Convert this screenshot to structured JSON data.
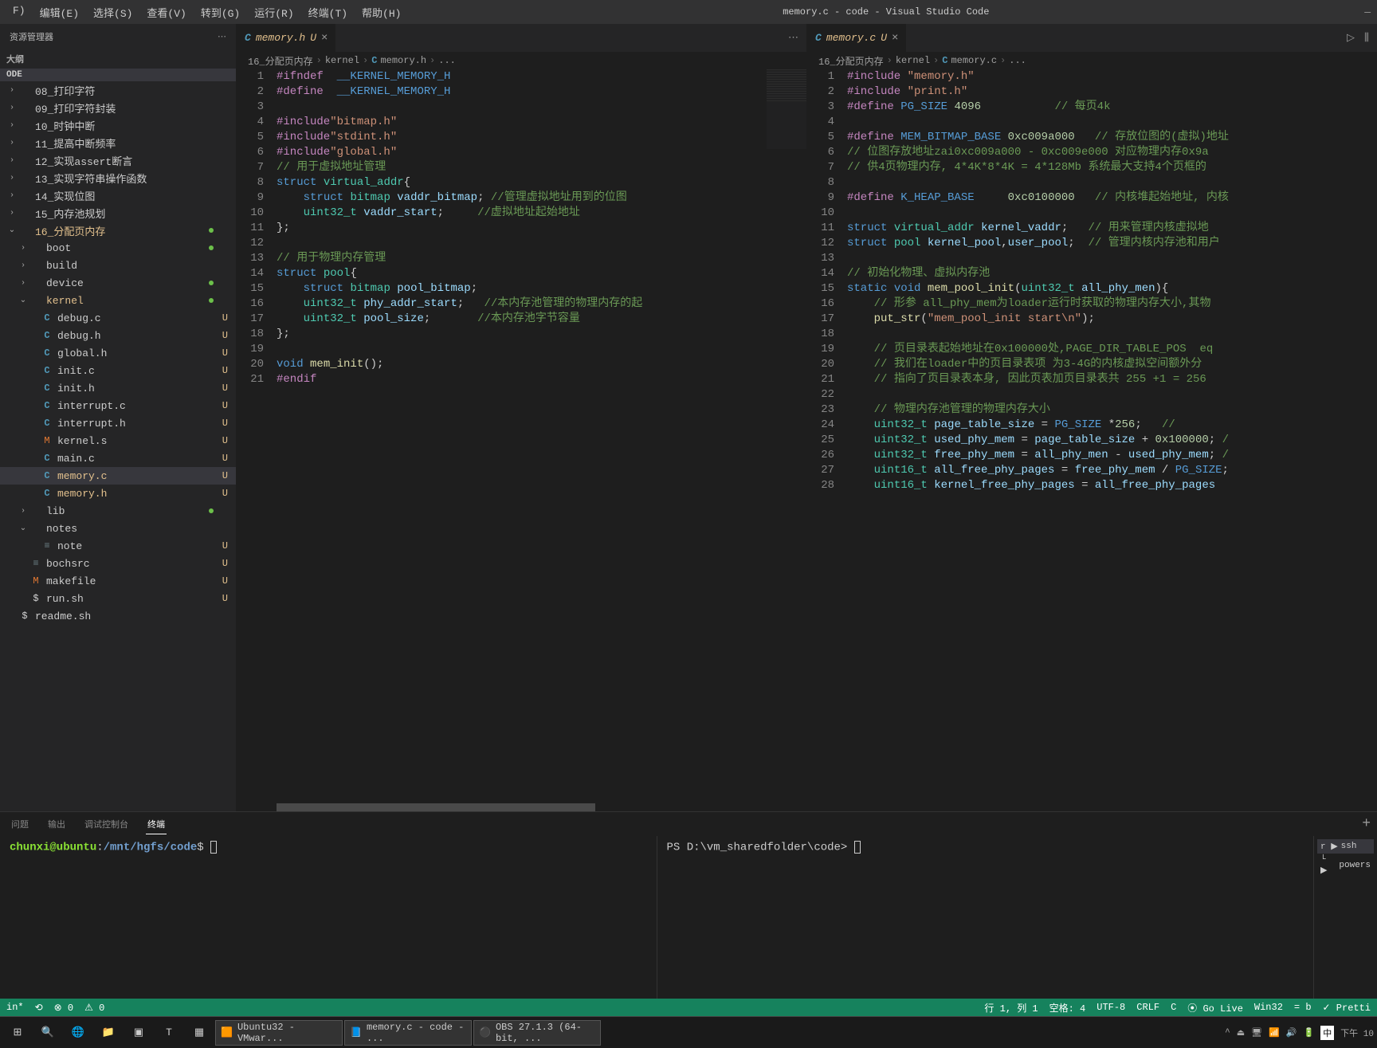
{
  "menu": {
    "items": [
      "F)",
      "编辑(E)",
      "选择(S)",
      "查看(V)",
      "转到(G)",
      "运行(R)",
      "终端(T)",
      "帮助(H)"
    ]
  },
  "window": {
    "title": "memory.c - code - Visual Studio Code"
  },
  "sidebar": {
    "title": "资源管理器",
    "outline": "大纲",
    "root": "ODE",
    "items": [
      {
        "name": "08_打印字符",
        "indent": 0,
        "kind": "folder"
      },
      {
        "name": "09_打印字符封装",
        "indent": 0,
        "kind": "folder"
      },
      {
        "name": "10_时钟中断",
        "indent": 0,
        "kind": "folder"
      },
      {
        "name": "11_提高中断频率",
        "indent": 0,
        "kind": "folder"
      },
      {
        "name": "12_实现assert断言",
        "indent": 0,
        "kind": "folder"
      },
      {
        "name": "13_实现字符串操作函数",
        "indent": 0,
        "kind": "folder"
      },
      {
        "name": "14_实现位图",
        "indent": 0,
        "kind": "folder"
      },
      {
        "name": "15_内存池规划",
        "indent": 0,
        "kind": "folder"
      },
      {
        "name": "16_分配页内存",
        "indent": 0,
        "kind": "folder",
        "open": true,
        "dot": true,
        "active": true
      },
      {
        "name": "boot",
        "indent": 1,
        "kind": "folder",
        "chev": "›",
        "dot": true
      },
      {
        "name": "build",
        "indent": 1,
        "kind": "folder",
        "chev": "›"
      },
      {
        "name": "device",
        "indent": 1,
        "kind": "folder",
        "chev": "›",
        "dot": true
      },
      {
        "name": "kernel",
        "indent": 1,
        "kind": "folder",
        "chev": "⌄",
        "open": true,
        "dot": true,
        "active": true
      },
      {
        "name": "debug.c",
        "indent": 2,
        "kind": "c",
        "status": "U"
      },
      {
        "name": "debug.h",
        "indent": 2,
        "kind": "c",
        "status": "U"
      },
      {
        "name": "global.h",
        "indent": 2,
        "kind": "c",
        "status": "U"
      },
      {
        "name": "init.c",
        "indent": 2,
        "kind": "c",
        "status": "U"
      },
      {
        "name": "init.h",
        "indent": 2,
        "kind": "c",
        "status": "U"
      },
      {
        "name": "interrupt.c",
        "indent": 2,
        "kind": "c",
        "status": "U"
      },
      {
        "name": "interrupt.h",
        "indent": 2,
        "kind": "c",
        "status": "U"
      },
      {
        "name": "kernel.s",
        "indent": 2,
        "kind": "m",
        "status": "U"
      },
      {
        "name": "main.c",
        "indent": 2,
        "kind": "c",
        "status": "U"
      },
      {
        "name": "memory.c",
        "indent": 2,
        "kind": "c",
        "status": "U",
        "selected": true,
        "active": true
      },
      {
        "name": "memory.h",
        "indent": 2,
        "kind": "c",
        "status": "U",
        "active": true
      },
      {
        "name": "lib",
        "indent": 1,
        "kind": "folder",
        "chev": "›",
        "dot": true
      },
      {
        "name": "notes",
        "indent": 1,
        "kind": "folder",
        "chev": "⌄",
        "open": true
      },
      {
        "name": "note",
        "indent": 2,
        "kind": "txt",
        "status": "U"
      },
      {
        "name": "bochsrc",
        "indent": 1,
        "kind": "txt",
        "status": "U"
      },
      {
        "name": "makefile",
        "indent": 1,
        "kind": "m",
        "status": "U"
      },
      {
        "name": "run.sh",
        "indent": 1,
        "kind": "sh",
        "status": "U"
      },
      {
        "name": "readme.sh",
        "indent": 0,
        "kind": "sh"
      }
    ]
  },
  "editor_left": {
    "tab": {
      "label": "memory.h",
      "modified": "U"
    },
    "breadcrumb": [
      "16_分配页内存",
      "kernel",
      "memory.h",
      "..."
    ],
    "lines": [
      {
        "n": 1,
        "raw": "<span class='tk-pp'>#ifndef</span>  <span class='tk-mac'>__KERNEL_MEMORY_H</span>"
      },
      {
        "n": 2,
        "raw": "<span class='tk-pp'>#define</span>  <span class='tk-mac'>__KERNEL_MEMORY_H</span>"
      },
      {
        "n": 3,
        "raw": ""
      },
      {
        "n": 4,
        "raw": "<span class='tk-inc'>#include</span><span class='tk-str'>\"bitmap.h\"</span>"
      },
      {
        "n": 5,
        "raw": "<span class='tk-inc'>#include</span><span class='tk-str'>\"stdint.h\"</span>"
      },
      {
        "n": 6,
        "raw": "<span class='tk-inc'>#include</span><span class='tk-str'>\"global.h\"</span>"
      },
      {
        "n": 7,
        "raw": "<span class='tk-com'>// 用于虚拟地址管理</span>"
      },
      {
        "n": 8,
        "raw": "<span class='tk-kw'>struct</span> <span class='tk-type'>virtual_addr</span>{"
      },
      {
        "n": 9,
        "raw": "    <span class='tk-kw'>struct</span> <span class='tk-type'>bitmap</span> <span class='tk-var'>vaddr_bitmap</span>; <span class='tk-com'>//管理虚拟地址用到的位图</span>"
      },
      {
        "n": 10,
        "raw": "    <span class='tk-type'>uint32_t</span> <span class='tk-var'>vaddr_start</span>;     <span class='tk-com'>//虚拟地址起始地址</span>"
      },
      {
        "n": 11,
        "raw": "};"
      },
      {
        "n": 12,
        "raw": ""
      },
      {
        "n": 13,
        "raw": "<span class='tk-com'>// 用于物理内存管理</span>"
      },
      {
        "n": 14,
        "raw": "<span class='tk-kw'>struct</span> <span class='tk-type'>pool</span>{"
      },
      {
        "n": 15,
        "raw": "    <span class='tk-kw'>struct</span> <span class='tk-type'>bitmap</span> <span class='tk-var'>pool_bitmap</span>;"
      },
      {
        "n": 16,
        "raw": "    <span class='tk-type'>uint32_t</span> <span class='tk-var'>phy_addr_start</span>;   <span class='tk-com'>//本内存池管理的物理内存的起</span>"
      },
      {
        "n": 17,
        "raw": "    <span class='tk-type'>uint32_t</span> <span class='tk-var'>pool_size</span>;       <span class='tk-com'>//本内存池字节容量</span>"
      },
      {
        "n": 18,
        "raw": "};"
      },
      {
        "n": 19,
        "raw": ""
      },
      {
        "n": 20,
        "raw": "<span class='tk-kw'>void</span> <span class='tk-fn'>mem_init</span>();"
      },
      {
        "n": 21,
        "raw": "<span class='tk-pp'>#endif</span>"
      }
    ]
  },
  "editor_right": {
    "tab": {
      "label": "memory.c",
      "modified": "U"
    },
    "breadcrumb": [
      "16_分配页内存",
      "kernel",
      "memory.c",
      "..."
    ],
    "lines": [
      {
        "n": 1,
        "raw": "<span class='tk-inc'>#include</span> <span class='tk-str'>\"memory.h\"</span>"
      },
      {
        "n": 2,
        "raw": "<span class='tk-inc'>#include</span> <span class='tk-str'>\"print.h\"</span>"
      },
      {
        "n": 3,
        "raw": "<span class='tk-pp'>#define</span> <span class='tk-mac'>PG_SIZE</span> <span class='tk-num'>4096</span>           <span class='tk-com'>// 每页4k</span>"
      },
      {
        "n": 4,
        "raw": ""
      },
      {
        "n": 5,
        "raw": "<span class='tk-pp'>#define</span> <span class='tk-mac'>MEM_BITMAP_BASE</span> <span class='tk-num'>0xc009a000</span>   <span class='tk-com'>// 存放位图的(虚拟)地址</span>"
      },
      {
        "n": 6,
        "raw": "<span class='tk-com'>// 位图存放地址zai0xc009a000 - 0xc009e000 对应物理内存0x9a</span>"
      },
      {
        "n": 7,
        "raw": "<span class='tk-com'>// 供4页物理内存, 4*4K*8*4K = 4*128Mb 系统最大支持4个页框的</span>"
      },
      {
        "n": 8,
        "raw": ""
      },
      {
        "n": 9,
        "raw": "<span class='tk-pp'>#define</span> <span class='tk-mac'>K_HEAP_BASE</span>     <span class='tk-num'>0xc0100000</span>   <span class='tk-com'>// 内核堆起始地址, 内核</span>"
      },
      {
        "n": 10,
        "raw": ""
      },
      {
        "n": 11,
        "raw": "<span class='tk-kw'>struct</span> <span class='tk-type'>virtual_addr</span> <span class='tk-var'>kernel_vaddr</span>;   <span class='tk-com'>// 用来管理内核虚拟地</span>"
      },
      {
        "n": 12,
        "raw": "<span class='tk-kw'>struct</span> <span class='tk-type'>pool</span> <span class='tk-var'>kernel_pool</span>,<span class='tk-var'>user_pool</span>;  <span class='tk-com'>// 管理内核内存池和用户</span>"
      },
      {
        "n": 13,
        "raw": "",
        "bp": true
      },
      {
        "n": 14,
        "raw": "<span class='tk-com'>// 初始化物理、虚拟内存池</span>"
      },
      {
        "n": 15,
        "raw": "<span class='tk-kw'>static</span> <span class='tk-kw'>void</span> <span class='tk-fn'>mem_pool_init</span>(<span class='tk-type'>uint32_t</span> <span class='tk-var'>all_phy_men</span>){"
      },
      {
        "n": 16,
        "raw": "    <span class='tk-com'>// 形参 all_phy_mem为loader运行时获取的物理内存大小,其物</span>"
      },
      {
        "n": 17,
        "raw": "    <span class='tk-fn'>put_str</span>(<span class='tk-str'>\"mem_pool_init start\\n\"</span>);"
      },
      {
        "n": 18,
        "raw": ""
      },
      {
        "n": 19,
        "raw": "    <span class='tk-com'>// 页目录表起始地址在0x100000处,PAGE_DIR_TABLE_POS  eq</span>"
      },
      {
        "n": 20,
        "raw": "    <span class='tk-com'>// 我们在loader中的页目录表项 为3-4G的内核虚拟空间额外分</span>"
      },
      {
        "n": 21,
        "raw": "    <span class='tk-com'>// 指向了页目录表本身, 因此页表加页目录表共 255 +1 = 256</span>"
      },
      {
        "n": 22,
        "raw": ""
      },
      {
        "n": 23,
        "raw": "    <span class='tk-com'>// 物理内存池管理的物理内存大小</span>"
      },
      {
        "n": 24,
        "raw": "    <span class='tk-type'>uint32_t</span> <span class='tk-var'>page_table_size</span> = <span class='tk-mac'>PG_SIZE</span> *<span class='tk-num'>256</span>;   <span class='tk-com'>//</span>"
      },
      {
        "n": 25,
        "raw": "    <span class='tk-type'>uint32_t</span> <span class='tk-var'>used_phy_mem</span> = <span class='tk-var'>page_table_size</span> + <span class='tk-num'>0x100000</span>; <span class='tk-com'>/</span>"
      },
      {
        "n": 26,
        "raw": "    <span class='tk-type'>uint32_t</span> <span class='tk-var'>free_phy_mem</span> = <span class='tk-var'>all_phy_men</span> - <span class='tk-var'>used_phy_mem</span>; <span class='tk-com'>/</span>"
      },
      {
        "n": 27,
        "raw": "    <span class='tk-type'>uint16_t</span> <span class='tk-var'>all_free_phy_pages</span> = <span class='tk-var'>free_phy_mem</span> / <span class='tk-mac'>PG_SIZE</span>;"
      },
      {
        "n": 28,
        "raw": "    <span class='tk-type'>uint16_t</span> <span class='tk-var'>kernel_free_phy_pages</span> = <span class='tk-var'>all_free_phy_pages</span>"
      }
    ]
  },
  "panel": {
    "tabs": [
      "问题",
      "输出",
      "调试控制台",
      "终端"
    ],
    "active": 3,
    "term1": {
      "user": "chunxi@ubuntu",
      "sep": ":",
      "path": "/mnt/hgfs/code",
      "suffix": "$"
    },
    "term2": {
      "prompt": "PS D:\\vm_sharedfolder\\code>"
    },
    "side": [
      {
        "label": "ssh",
        "active": true,
        "prefix": "r ▶"
      },
      {
        "label": "powers",
        "prefix": "└ ▶"
      }
    ]
  },
  "status": {
    "remote": "in*",
    "sync": "⟲",
    "errors": "⊗ 0",
    "warnings": "⚠ 0",
    "cursor": "行 1, 列 1",
    "spaces": "空格: 4",
    "encoding": "UTF-8",
    "eol": "CRLF",
    "lang": "C",
    "golive": "⦿ Go Live",
    "win32": "Win32",
    "beautify": "= b",
    "prettier": "✓ Pretti"
  },
  "taskbar": {
    "apps": [
      {
        "label": "Ubuntu32 - VMwar..."
      },
      {
        "label": "memory.c - code - ..."
      },
      {
        "label": "OBS 27.1.3 (64-bit, ..."
      }
    ],
    "tray": {
      "ime": "中",
      "time": "下午 10"
    }
  }
}
